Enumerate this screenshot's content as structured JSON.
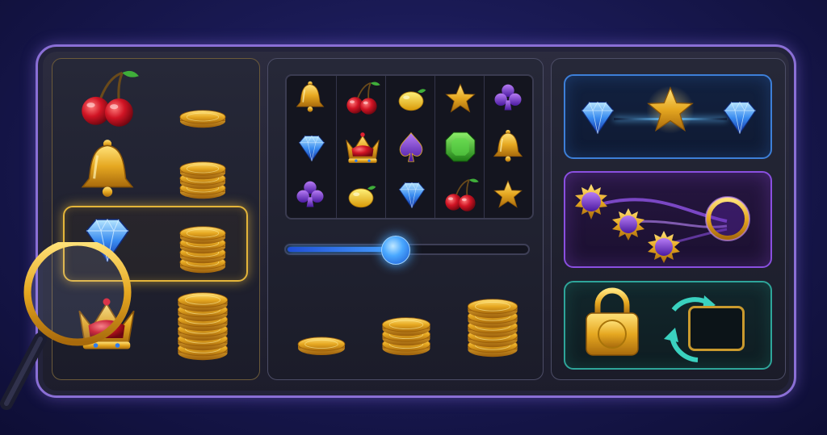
{
  "scene": {
    "panels": [
      "paytable",
      "reels-and-bet",
      "features"
    ]
  },
  "paytable": {
    "rows": [
      {
        "symbol": "cherry-icon",
        "coin_stack": 1
      },
      {
        "symbol": "bell-icon",
        "coin_stack": 3
      },
      {
        "symbol": "diamond-icon",
        "coin_stack": 4,
        "highlighted": true
      },
      {
        "symbol": "crown-icon",
        "coin_stack": 6
      }
    ]
  },
  "reels": {
    "grid": [
      [
        "bell-icon",
        "cherry-icon",
        "lemon-icon",
        "star-icon",
        "club-icon"
      ],
      [
        "diamond-icon",
        "crown-icon",
        "spade-icon",
        "emerald-icon",
        "bell-icon"
      ],
      [
        "club-icon",
        "lemon-icon",
        "diamond-icon",
        "cherry-icon",
        "star-icon"
      ]
    ]
  },
  "bet": {
    "slider_level": 0.45,
    "coin_stacks": [
      1,
      3,
      5
    ]
  },
  "features": {
    "cards": [
      "diamond-star-link",
      "orb-portal",
      "lock-respin"
    ]
  },
  "colors": {
    "gold": "#e4b53a",
    "blue": "#3d7fd8",
    "purple": "#8a4fe0",
    "teal": "#2ea59a",
    "frame": "#8a6fd6"
  }
}
